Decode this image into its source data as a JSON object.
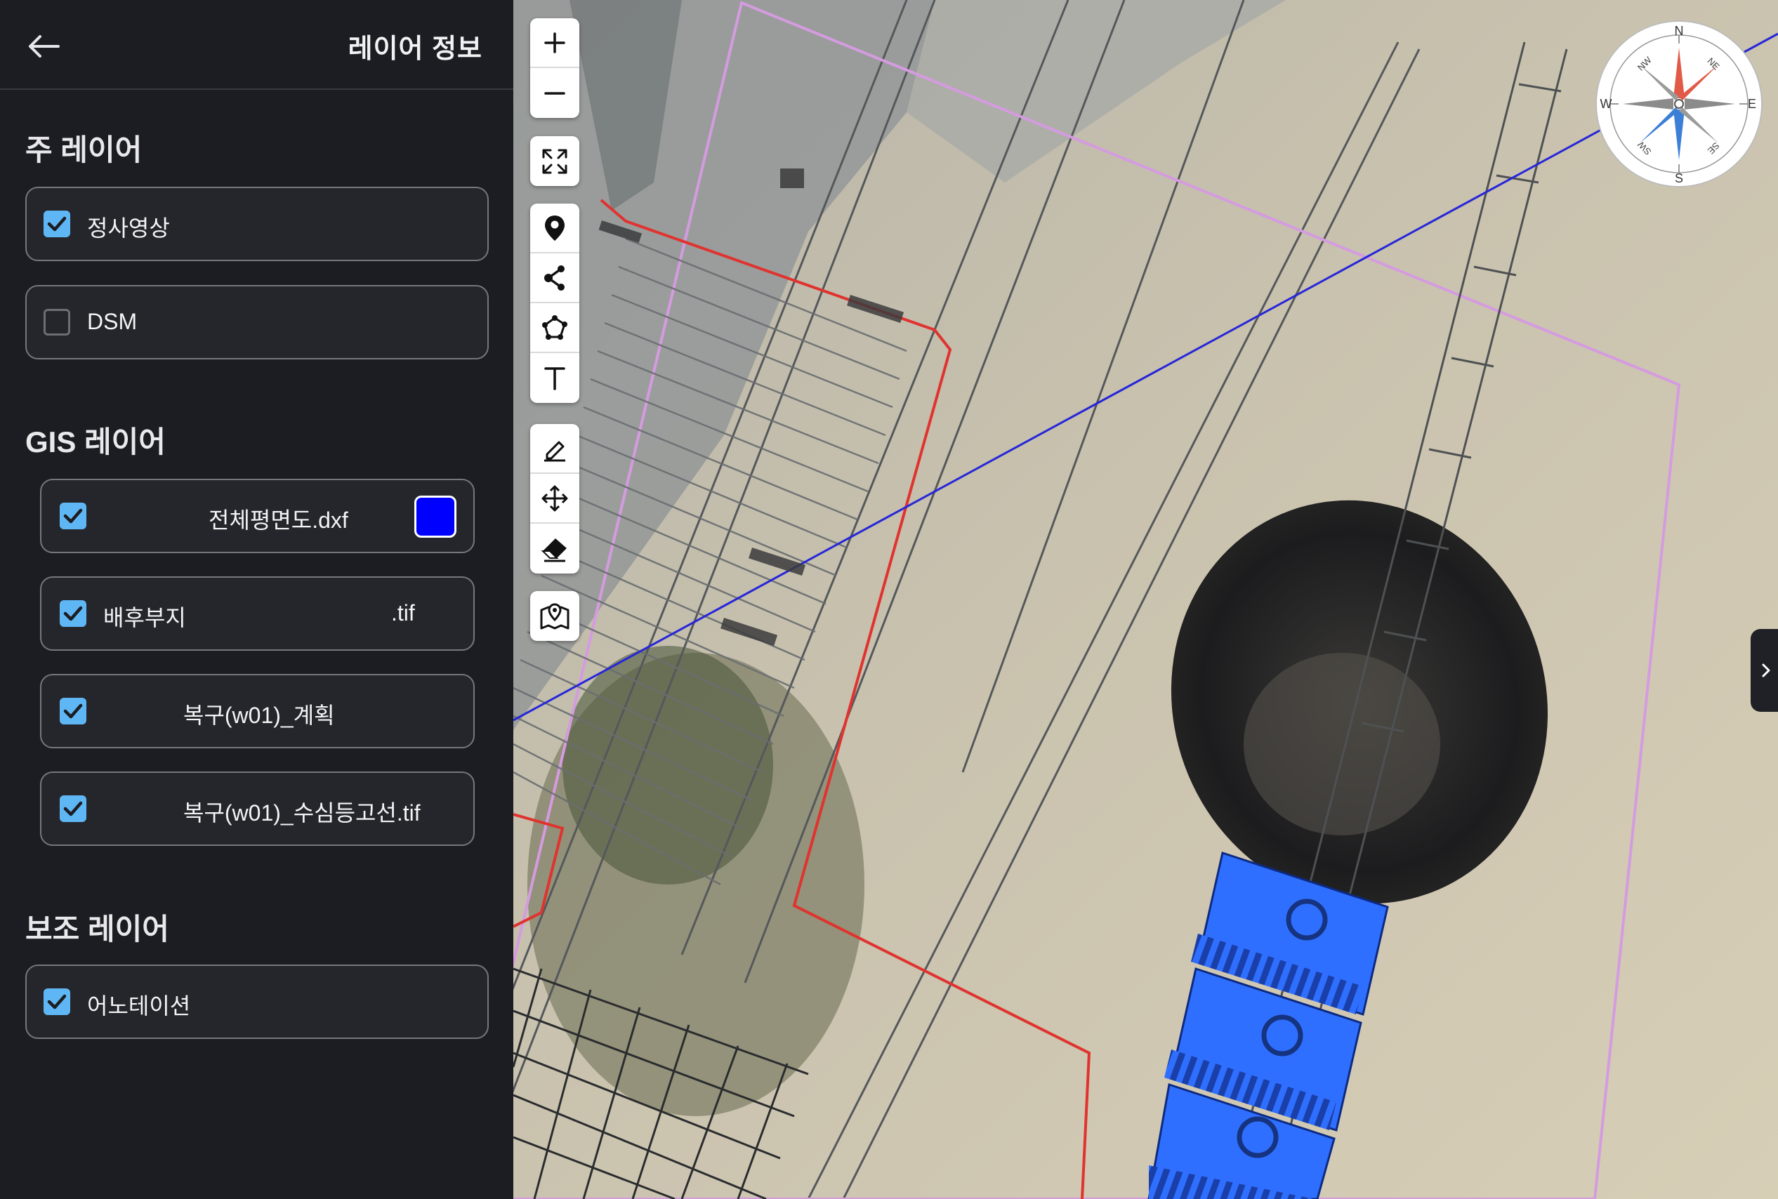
{
  "panel": {
    "title": "레이어 정보",
    "back_icon": "arrow-left-icon"
  },
  "sections": {
    "main": {
      "title": "주 레이어",
      "layers": [
        {
          "label": "정사영상",
          "checked": true
        },
        {
          "label": "DSM",
          "checked": false
        }
      ]
    },
    "gis": {
      "title": "GIS 레이어",
      "layers": [
        {
          "label": "전체평면도.dxf",
          "checked": true,
          "color": "#0000ff"
        },
        {
          "label": "배후부지",
          "suffix": ".tif",
          "checked": true
        },
        {
          "label": "복구(w01)_계획",
          "checked": true
        },
        {
          "label": "복구(w01)_수심등고선.tif",
          "checked": true
        }
      ]
    },
    "aux": {
      "title": "보조 레이어",
      "layers": [
        {
          "label": "어노테이션",
          "checked": true
        }
      ]
    }
  },
  "toolbar": {
    "groups": [
      [
        "zoom-in-icon",
        "zoom-out-icon"
      ],
      [
        "fullscreen-icon"
      ],
      [
        "marker-icon",
        "polyline-icon",
        "polygon-icon",
        "text-icon"
      ],
      [
        "edit-pencil-icon",
        "move-icon",
        "eraser-icon"
      ],
      [
        "map-icon"
      ]
    ]
  },
  "compass": {
    "labels": {
      "n": "N",
      "s": "S",
      "e": "E",
      "w": "W",
      "ne": "NE",
      "nw": "NW",
      "se": "SE",
      "sw": "SW"
    }
  },
  "colors": {
    "accent": "#5fb6f5",
    "panel_bg": "#1c1d22",
    "dxf_layer_color": "#0000ff",
    "parking_blue": "#2f6fff",
    "red_boundary": "#e0332f",
    "pink_boundary": "#d59be0"
  }
}
